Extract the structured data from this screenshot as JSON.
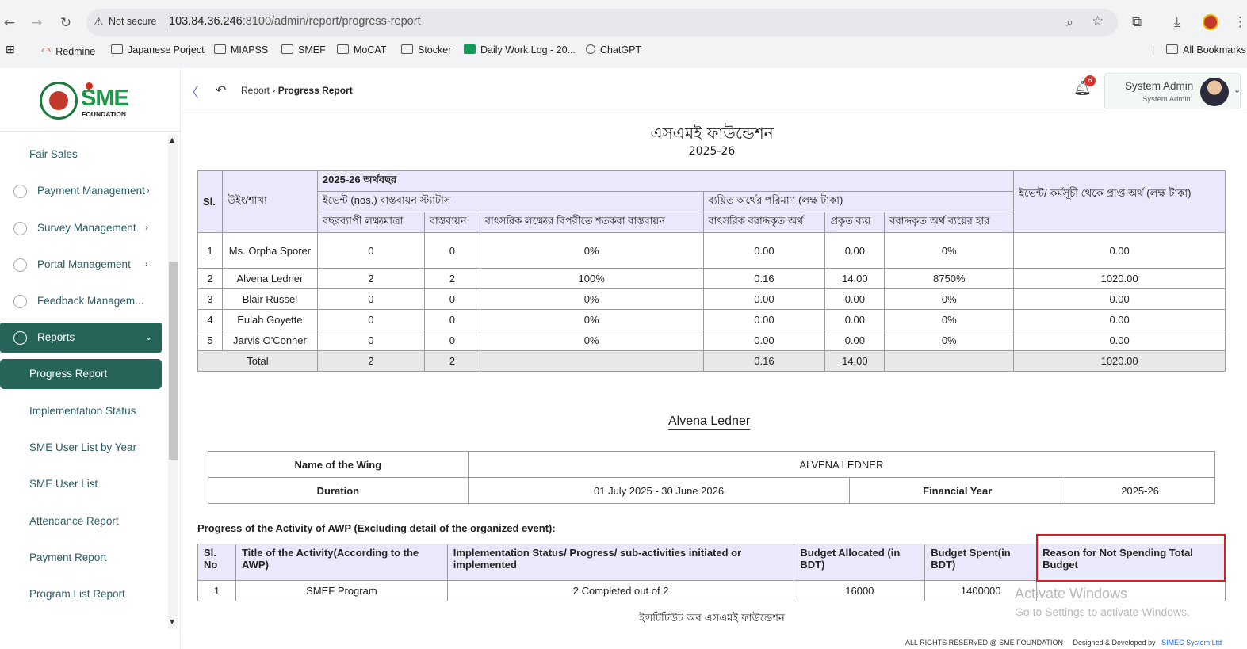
{
  "browser": {
    "security_label": "Not secure",
    "url_host": "103.84.36.246",
    "url_rest": ":8100/admin/report/progress-report",
    "bookmarks": [
      "Redmine",
      "Japanese Porject",
      "MIAPSS",
      "SMEF",
      "MoCAT",
      "Stocker",
      "Daily Work Log - 20...",
      "ChatGPT"
    ],
    "all_bookmarks": "All Bookmarks"
  },
  "logo": {
    "brand": "SME",
    "subtitle": "FOUNDATION"
  },
  "sidebar": {
    "items": [
      {
        "label": "Fair Sales"
      },
      {
        "label": "Payment Management",
        "arrow": "›"
      },
      {
        "label": "Survey Management",
        "arrow": "›"
      },
      {
        "label": "Portal Management",
        "arrow": "›"
      },
      {
        "label": "Feedback Managem..."
      },
      {
        "label": "Reports",
        "arrow": "⌄"
      },
      {
        "label": "Progress Report"
      },
      {
        "label": "Implementation Status"
      },
      {
        "label": "SME User List by Year"
      },
      {
        "label": "SME User List"
      },
      {
        "label": "Attendance Report"
      },
      {
        "label": "Payment Report"
      },
      {
        "label": "Program List Report"
      }
    ]
  },
  "header": {
    "breadcrumb_parent": "Report",
    "breadcrumb_current": "Progress Report",
    "notification_count": "6",
    "user_name": "System Admin",
    "user_role": "System Admin"
  },
  "report": {
    "org_title": "এসএমই ফাউন্ডেশন",
    "year": "2025-26",
    "summary_table": {
      "h_sl": "Sl.",
      "h_wing": "উইং/শাখা",
      "h_fiscal": "2025-26 অর্থবছর",
      "h_event_status": "ইভেন্ট (nos.) বাস্তবায়ন স্ট্যাটাস",
      "h_spent_amount": "ব্যয়িত অর্থের পরিমাণ (লক্ষ টাকা)",
      "h_received": "ইভেন্ট/ কর্মসূচী থেকে প্রাপ্ত অর্থ (লক্ষ টাকা)",
      "h_annual_target": "বছরব্যাপী লক্ষ্যমাত্রা",
      "h_implemented": "বাস্তবায়ন",
      "h_pct_target": "বাৎসরিক লক্ষ্যের বিপরীতে শতকরা বাস্তবায়ন",
      "h_annual_alloc": "বাৎসরিক বরাদ্দকৃত অর্থ",
      "h_actual": "প্রকৃত ব্যয়",
      "h_alloc_rate": "বরাদ্দকৃত অর্থ ব্যয়ের হার",
      "rows": [
        {
          "sl": "1",
          "wing": "Ms. Orpha Sporer",
          "target": "0",
          "impl": "0",
          "pct": "0%",
          "alloc": "0.00",
          "actual": "0.00",
          "rate": "0%",
          "received": "0.00"
        },
        {
          "sl": "2",
          "wing": "Alvena Ledner",
          "target": "2",
          "impl": "2",
          "pct": "100%",
          "alloc": "0.16",
          "actual": "14.00",
          "rate": "8750%",
          "received": "1020.00"
        },
        {
          "sl": "3",
          "wing": "Blair Russel",
          "target": "0",
          "impl": "0",
          "pct": "0%",
          "alloc": "0.00",
          "actual": "0.00",
          "rate": "0%",
          "received": "0.00"
        },
        {
          "sl": "4",
          "wing": "Eulah Goyette",
          "target": "0",
          "impl": "0",
          "pct": "0%",
          "alloc": "0.00",
          "actual": "0.00",
          "rate": "0%",
          "received": "0.00"
        },
        {
          "sl": "5",
          "wing": "Jarvis O'Conner",
          "target": "0",
          "impl": "0",
          "pct": "0%",
          "alloc": "0.00",
          "actual": "0.00",
          "rate": "0%",
          "received": "0.00"
        }
      ],
      "total": {
        "label": "Total",
        "target": "2",
        "impl": "2",
        "alloc": "0.16",
        "actual": "14.00",
        "received": "1020.00"
      }
    },
    "wing_section": {
      "title": "Alvena Ledner",
      "name_label": "Name of the Wing",
      "name_value": "ALVENA LEDNER",
      "duration_label": "Duration",
      "duration_value": "01 July 2025 - 30 June 2026",
      "fy_label": "Financial Year",
      "fy_value": "2025-26"
    },
    "activity": {
      "title": "Progress of the Activity of AWP (Excluding detail of the organized event):",
      "h_sl": "Sl. No",
      "h_title": "Title of the Activity(According to the AWP)",
      "h_status": "Implementation Status/ Progress/ sub-activities initiated or implemented",
      "h_alloc": "Budget Allocated (in BDT)",
      "h_spent": "Budget Spent(in BDT)",
      "h_reason": "Reason for Not Spending Total Budget",
      "rows": [
        {
          "sl": "1",
          "title": "SMEF Program",
          "status": "2 Completed out of 2",
          "alloc": "16000",
          "spent": "1400000",
          "reason": ""
        }
      ]
    },
    "institute": "ইন্সটিটিউট অব এসএমই ফাউন্ডেশন"
  },
  "watermark": {
    "line1": "Activate Windows",
    "line2": "Go to Settings to activate Windows."
  },
  "footer": {
    "rights": "ALL RIGHTS RESERVED @ SME FOUNDATION",
    "designed": "Designed & Developed by",
    "company": "SIMEC System Ltd"
  },
  "colors": {
    "sidebar_active": "#26645a",
    "table_header": "#e9e9fb",
    "highlight_box": "#e01b1b"
  }
}
